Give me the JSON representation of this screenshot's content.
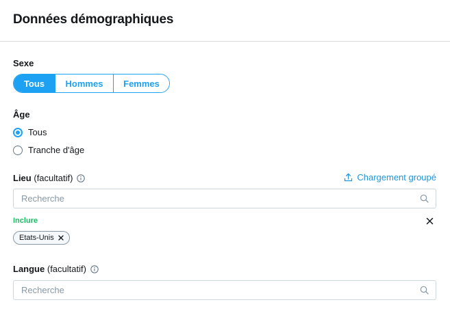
{
  "header": {
    "title": "Données démographiques"
  },
  "gender": {
    "label": "Sexe",
    "options": [
      {
        "label": "Tous",
        "selected": true
      },
      {
        "label": "Hommes",
        "selected": false
      },
      {
        "label": "Femmes",
        "selected": false
      }
    ]
  },
  "age": {
    "label": "Âge",
    "options": [
      {
        "label": "Tous",
        "checked": true
      },
      {
        "label": "Tranche d'âge",
        "checked": false
      }
    ]
  },
  "location": {
    "label": "Lieu",
    "optional_label": "(facultatif)",
    "bulk_upload_label": "Chargement groupé",
    "search_placeholder": "Recherche",
    "include_label": "Inclure",
    "tags": [
      {
        "label": "Etats-Unis"
      }
    ]
  },
  "language": {
    "label": "Langue",
    "optional_label": "(facultatif)",
    "search_placeholder": "Recherche"
  },
  "colors": {
    "accent": "#1da1f2",
    "link": "#1b95e0",
    "include_green": "#17bf63",
    "border": "#ccd6dd",
    "text": "#14171a"
  },
  "icons": {
    "info": "info-icon",
    "upload": "upload-icon",
    "search": "search-icon",
    "close": "close-icon"
  }
}
